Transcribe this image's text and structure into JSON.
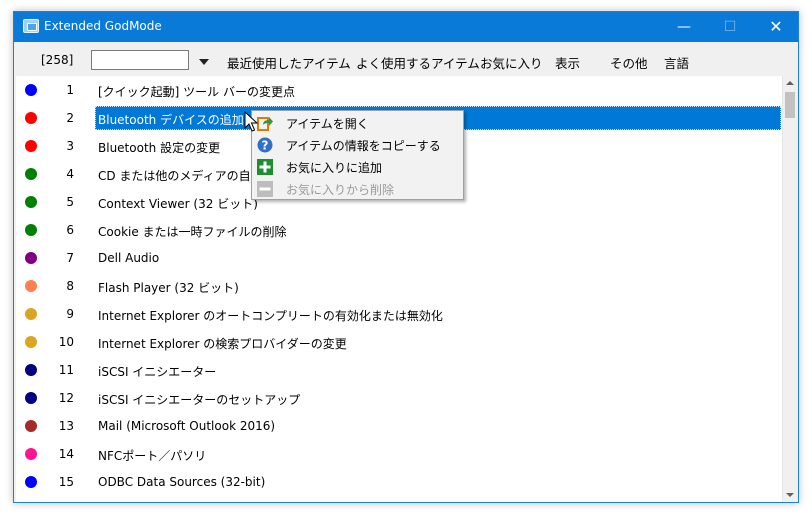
{
  "window": {
    "title": "Extended GodMode"
  },
  "titlebar": {
    "minimize": "—",
    "maximize": "☐",
    "close": "✕"
  },
  "toolbar": {
    "count": "[258]",
    "search_value": "",
    "menu": [
      "最近使用したアイテム",
      "よく使用するアイテム",
      "お気に入り",
      "表示",
      "その他",
      "言語"
    ]
  },
  "colors": {
    "titlebar": "#0a7ad8",
    "selection": "#0078d7"
  },
  "list": {
    "rows": [
      {
        "num": "1",
        "label": "[クイック起動] ツール バーの変更点",
        "color": "#0000ff"
      },
      {
        "num": "2",
        "label": "Bluetooth デバイスの追加",
        "color": "#ff0000",
        "selected": true
      },
      {
        "num": "3",
        "label": "Bluetooth 設定の変更",
        "color": "#ff0000"
      },
      {
        "num": "4",
        "label": "CD または他のメディアの自動再",
        "color": "#008000"
      },
      {
        "num": "5",
        "label": "Context Viewer (32 ビット)",
        "color": "#008000"
      },
      {
        "num": "6",
        "label": "Cookie または一時ファイルの削除",
        "color": "#008000"
      },
      {
        "num": "7",
        "label": "Dell Audio",
        "color": "#800080"
      },
      {
        "num": "8",
        "label": "Flash Player (32 ビット)",
        "color": "#ff7f50"
      },
      {
        "num": "9",
        "label": "Internet Explorer のオートコンプリートの有効化または無効化",
        "color": "#daa520"
      },
      {
        "num": "10",
        "label": "Internet Explorer の検索プロバイダーの変更",
        "color": "#daa520"
      },
      {
        "num": "11",
        "label": "iSCSI イニシエーター",
        "color": "#000080"
      },
      {
        "num": "12",
        "label": "iSCSI イニシエーターのセットアップ",
        "color": "#000080"
      },
      {
        "num": "13",
        "label": "Mail (Microsoft Outlook 2016)",
        "color": "#a52a2a"
      },
      {
        "num": "14",
        "label": "NFCポート／パソリ",
        "color": "#ff1493"
      },
      {
        "num": "15",
        "label": "ODBC Data Sources (32-bit)",
        "color": "#0000ff"
      }
    ]
  },
  "context_menu": {
    "items": [
      {
        "label": "アイテムを開く",
        "icon": "open-icon",
        "enabled": true
      },
      {
        "label": "アイテムの情報をコピーする",
        "icon": "info-icon",
        "enabled": true
      },
      {
        "label": "お気に入りに追加",
        "icon": "add-icon",
        "enabled": true
      },
      {
        "label": "お気に入りから削除",
        "icon": "remove-icon",
        "enabled": false
      }
    ]
  }
}
